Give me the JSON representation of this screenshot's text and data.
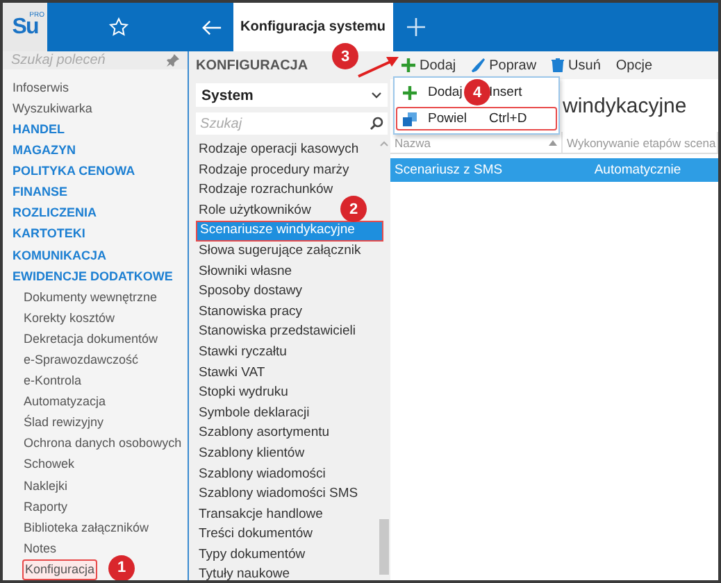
{
  "header": {
    "logo": "Su",
    "logo_badge": "PRO",
    "tab_title": "Konfiguracja systemu"
  },
  "sidebar": {
    "search": {
      "placeholder": "Szukaj poleceń"
    },
    "items": [
      {
        "label": "Infoserwis",
        "kind": "link"
      },
      {
        "label": "Wyszukiwarka",
        "kind": "link"
      },
      {
        "label": "HANDEL",
        "kind": "section"
      },
      {
        "label": "MAGAZYN",
        "kind": "section"
      },
      {
        "label": "POLITYKA CENOWA",
        "kind": "section"
      },
      {
        "label": "FINANSE",
        "kind": "section"
      },
      {
        "label": "ROZLICZENIA",
        "kind": "section"
      },
      {
        "label": "KARTOTEKI",
        "kind": "section"
      },
      {
        "label": "KOMUNIKACJA",
        "kind": "section"
      },
      {
        "label": "EWIDENCJE DODATKOWE",
        "kind": "section",
        "children": [
          {
            "label": "Dokumenty wewnętrzne",
            "outlined": false
          },
          {
            "label": "Korekty kosztów",
            "outlined": false
          },
          {
            "label": "Dekretacja dokumentów",
            "outlined": false
          },
          {
            "label": "e-Sprawozdawczość",
            "outlined": false
          },
          {
            "label": "e-Kontrola",
            "outlined": false
          },
          {
            "label": "Automatyzacja",
            "outlined": false
          },
          {
            "label": "Ślad rewizyjny",
            "outlined": false
          },
          {
            "label": "Ochrona danych osobowych",
            "outlined": false
          },
          {
            "label": "Schowek",
            "outlined": false
          },
          {
            "label": "Naklejki",
            "outlined": false
          },
          {
            "label": "Raporty",
            "outlined": false
          },
          {
            "label": "Biblioteka załączników",
            "outlined": false
          },
          {
            "label": "Notes",
            "outlined": false
          },
          {
            "label": "Konfiguracja",
            "outlined": true,
            "callout": "1"
          }
        ]
      }
    ]
  },
  "config": {
    "heading": "KONFIGURACJA",
    "module": "System",
    "search": {
      "placeholder": "Szukaj"
    },
    "items": [
      {
        "label": "Rodzaje operacji kasowych",
        "selected": false
      },
      {
        "label": "Rodzaje procedury marży",
        "selected": false
      },
      {
        "label": "Rodzaje rozrachunków",
        "selected": false
      },
      {
        "label": "Role użytkowników",
        "selected": false
      },
      {
        "label": "Scenariusze windykacyjne",
        "selected": true,
        "callout": "2"
      },
      {
        "label": "Słowa sugerujące załącznik",
        "selected": false
      },
      {
        "label": "Słowniki własne",
        "selected": false
      },
      {
        "label": "Sposoby dostawy",
        "selected": false
      },
      {
        "label": "Stanowiska pracy",
        "selected": false
      },
      {
        "label": "Stanowiska przedstawicieli",
        "selected": false
      },
      {
        "label": "Stawki ryczałtu",
        "selected": false
      },
      {
        "label": "Stawki VAT",
        "selected": false
      },
      {
        "label": "Stopki wydruku",
        "selected": false
      },
      {
        "label": "Symbole deklaracji",
        "selected": false
      },
      {
        "label": "Szablony asortymentu",
        "selected": false
      },
      {
        "label": "Szablony klientów",
        "selected": false
      },
      {
        "label": "Szablony wiadomości",
        "selected": false
      },
      {
        "label": "Szablony wiadomości SMS",
        "selected": false
      },
      {
        "label": "Transakcje handlowe",
        "selected": false
      },
      {
        "label": "Treści dokumentów",
        "selected": false
      },
      {
        "label": "Typy dokumentów",
        "selected": false
      },
      {
        "label": "Tytuły naukowe",
        "selected": false
      }
    ]
  },
  "toolbar": [
    {
      "label": "Dodaj",
      "has_menu": true,
      "callout": "3"
    },
    {
      "label": "Popraw"
    },
    {
      "label": "Usuń"
    },
    {
      "label": "Opcje"
    }
  ],
  "menu": [
    {
      "label": "Dodaj",
      "shortcut": "Insert",
      "outlined": false,
      "callout": "4"
    },
    {
      "label": "Powiel",
      "shortcut": "Ctrl+D",
      "outlined": true
    }
  ],
  "page_title": "windykacyjne",
  "table": {
    "columns": [
      {
        "label": "Nazwa",
        "sorted": true
      },
      {
        "label": "Wykonywanie etapów scena",
        "sorted": false
      }
    ],
    "rows": [
      {
        "cells": [
          "Scenariusz z SMS",
          "Automatycznie"
        ],
        "selected": true
      }
    ]
  }
}
